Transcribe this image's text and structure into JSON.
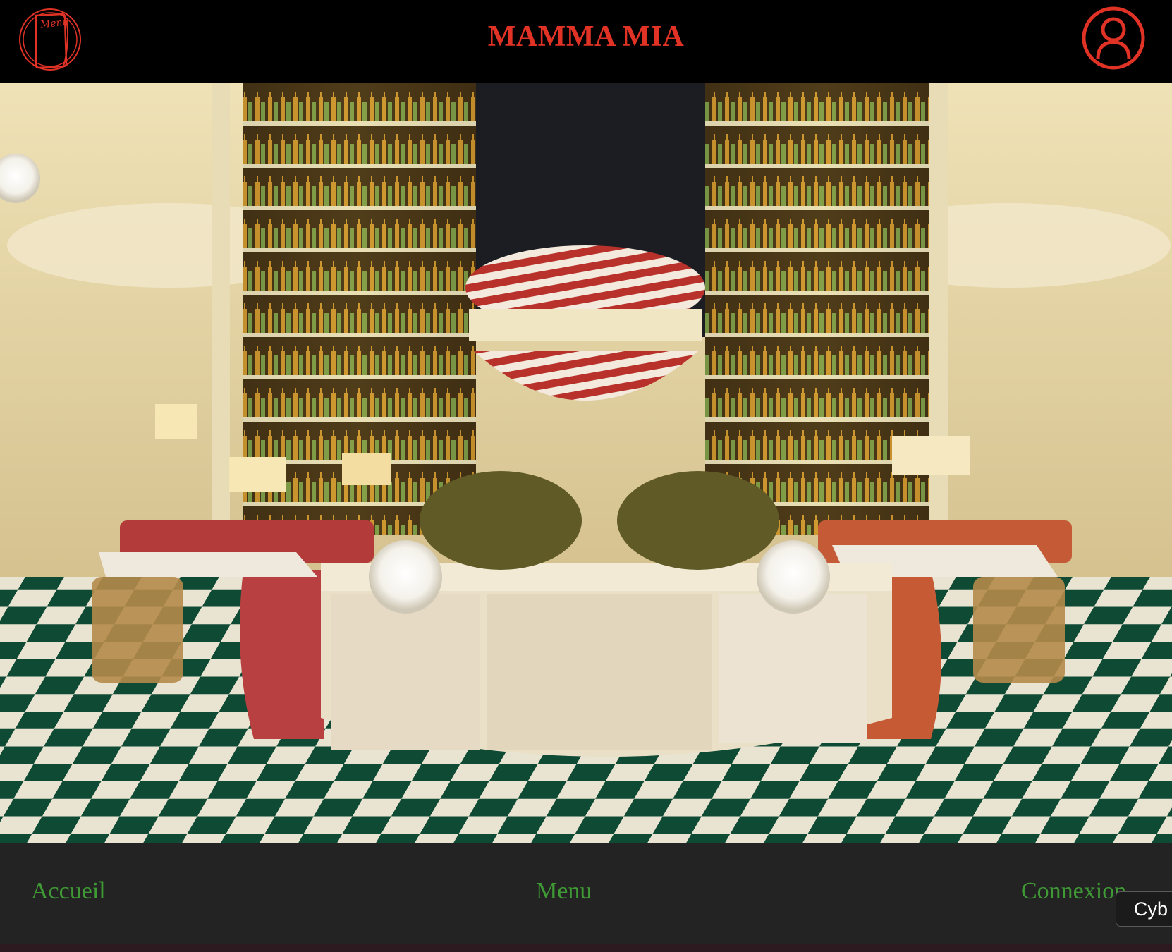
{
  "header": {
    "title": "MAMMA MIA",
    "menu_icon_text": "Menu",
    "menu_icon_name": "menu-book-icon",
    "user_icon_name": "user-account-icon",
    "accent_color": "#e03326"
  },
  "hero": {
    "alt": "Restaurant interior photo"
  },
  "nav": {
    "items": [
      {
        "label": "Accueil"
      },
      {
        "label": "Menu"
      },
      {
        "label": "Connexion"
      }
    ],
    "link_color": "#3f9a35",
    "background": "#232323"
  },
  "tooltip": {
    "text": "Cyb"
  }
}
